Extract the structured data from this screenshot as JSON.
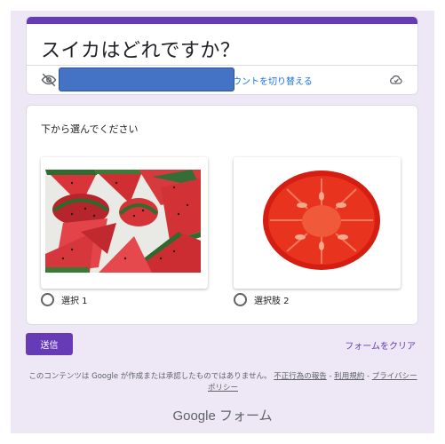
{
  "form": {
    "title": "スイカはどれですか？",
    "account_switch_label": "ウントを切り替える",
    "accent_color": "#673ab7"
  },
  "question": {
    "prompt": "下から選んでください",
    "options": [
      {
        "label": "選択 1",
        "image": "watermelon-slices-photo"
      },
      {
        "label": "選択肢 2",
        "image": "tomato-slice-photo"
      }
    ]
  },
  "actions": {
    "submit_label": "送信",
    "clear_label": "フォームをクリア"
  },
  "footer": {
    "disclaimer_text": "このコンテンツは Google が作成または承認したものではありません。",
    "report_link": "不正行為の報告",
    "sep1": " - ",
    "terms_link": "利用規約",
    "sep2": " - ",
    "privacy_link": "プライバシー ポリシー",
    "logo_text": "Google フォーム"
  },
  "icons": {
    "visibility_off": "eye-off-icon",
    "cloud": "cloud-icon"
  }
}
